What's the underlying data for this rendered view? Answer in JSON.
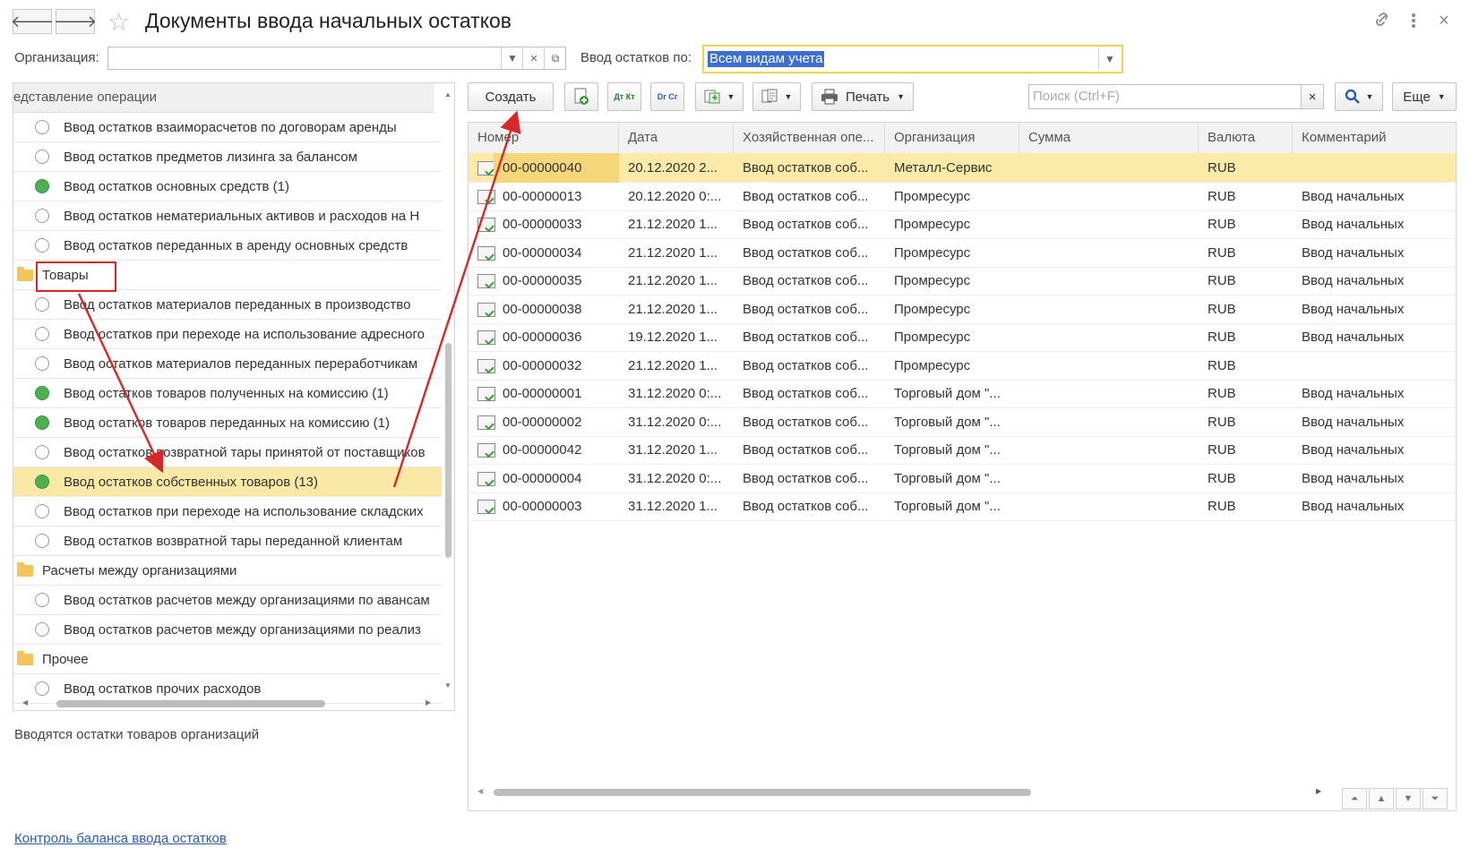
{
  "window": {
    "title": "Документы ввода начальных остатков",
    "back_label": "🡐",
    "forward_label": "🡒",
    "star_icon": "star-icon",
    "link_icon": "link-icon",
    "more_icon": "more-vertical-icon",
    "close_label": "×"
  },
  "filters": {
    "org_label": "Организация:",
    "org_value": "",
    "entry_label": "Ввод остатков по:",
    "entry_value": "Всем видам учета"
  },
  "tree": {
    "header": "едставление операции",
    "items": [
      {
        "type": "radio",
        "label": "Ввод остатков взаиморасчетов по договорам аренды",
        "checked": false
      },
      {
        "type": "radio",
        "label": "Ввод остатков предметов лизинга за балансом",
        "checked": false
      },
      {
        "type": "radio",
        "label": "Ввод остатков основных средств (1)",
        "checked": true
      },
      {
        "type": "radio",
        "label": "Ввод остатков нематериальных активов и расходов на Н",
        "checked": false
      },
      {
        "type": "radio",
        "label": "Ввод остатков переданных в аренду основных средств",
        "checked": false
      },
      {
        "type": "folder",
        "label": "Товары"
      },
      {
        "type": "radio",
        "label": "Ввод остатков материалов переданных в производство",
        "checked": false
      },
      {
        "type": "radio",
        "label": "Ввод остатков при переходе на использование адресного",
        "checked": false
      },
      {
        "type": "radio",
        "label": "Ввод остатков материалов переданных переработчикам",
        "checked": false
      },
      {
        "type": "radio",
        "label": "Ввод остатков товаров полученных на комиссию (1)",
        "checked": true
      },
      {
        "type": "radio",
        "label": "Ввод остатков товаров переданных на комиссию (1)",
        "checked": true
      },
      {
        "type": "radio",
        "label": "Ввод остатков возвратной тары принятой от поставщиков",
        "checked": false
      },
      {
        "type": "radio",
        "label": "Ввод остатков собственных товаров (13)",
        "checked": true,
        "selected": true
      },
      {
        "type": "radio",
        "label": "Ввод остатков при переходе на использование складских",
        "checked": false
      },
      {
        "type": "radio",
        "label": "Ввод остатков возвратной тары переданной клиентам",
        "checked": false
      },
      {
        "type": "folder",
        "label": "Расчеты между организациями"
      },
      {
        "type": "radio",
        "label": "Ввод остатков расчетов между организациями по авансам",
        "checked": false
      },
      {
        "type": "radio",
        "label": "Ввод остатков расчетов между организациями по реализ",
        "checked": false
      },
      {
        "type": "folder",
        "label": "Прочее"
      },
      {
        "type": "radio",
        "label": "Ввод остатков прочих расходов",
        "checked": false
      }
    ]
  },
  "hint": "Вводятся остатки товаров организаций",
  "balance_link": "Контроль баланса ввода остатков",
  "toolbar": {
    "create_label": "Создать",
    "dtkt_label": "Дт Кт",
    "drcr_label": "Dr Cr",
    "print_label": "Печать",
    "search_placeholder": "Поиск (Ctrl+F)",
    "more_label": "Еще"
  },
  "grid": {
    "columns": [
      "Номер",
      "Дата",
      "Хозяйственная опе...",
      "Организация",
      "Сумма",
      "Валюта",
      "Комментарий"
    ],
    "rows": [
      {
        "num": "00-00000040",
        "date": "20.12.2020 2...",
        "op": "Ввод остатков соб...",
        "org": "Металл-Сервис",
        "sum": "",
        "cur": "RUB",
        "comment": "",
        "selected": true
      },
      {
        "num": "00-00000013",
        "date": "20.12.2020 0:...",
        "op": "Ввод остатков соб...",
        "org": "Промресурс",
        "sum": "",
        "cur": "RUB",
        "comment": "Ввод начальных"
      },
      {
        "num": "00-00000033",
        "date": "21.12.2020 1...",
        "op": "Ввод остатков соб...",
        "org": "Промресурс",
        "sum": "",
        "cur": "RUB",
        "comment": "Ввод начальных"
      },
      {
        "num": "00-00000034",
        "date": "21.12.2020 1...",
        "op": "Ввод остатков соб...",
        "org": "Промресурс",
        "sum": "",
        "cur": "RUB",
        "comment": "Ввод начальных"
      },
      {
        "num": "00-00000035",
        "date": "21.12.2020 1...",
        "op": "Ввод остатков соб...",
        "org": "Промресурс",
        "sum": "",
        "cur": "RUB",
        "comment": "Ввод начальных"
      },
      {
        "num": "00-00000038",
        "date": "21.12.2020 1...",
        "op": "Ввод остатков соб...",
        "org": "Промресурс",
        "sum": "",
        "cur": "RUB",
        "comment": "Ввод начальных"
      },
      {
        "num": "00-00000036",
        "date": "19.12.2020 1...",
        "op": "Ввод остатков соб...",
        "org": "Промресурс",
        "sum": "",
        "cur": "RUB",
        "comment": "Ввод начальных"
      },
      {
        "num": "00-00000032",
        "date": "21.12.2020 1...",
        "op": "Ввод остатков соб...",
        "org": "Промресурс",
        "sum": "",
        "cur": "RUB",
        "comment": ""
      },
      {
        "num": "00-00000001",
        "date": "31.12.2020 0:...",
        "op": "Ввод остатков соб...",
        "org": "Торговый дом \"...",
        "sum": "",
        "cur": "RUB",
        "comment": "Ввод начальных"
      },
      {
        "num": "00-00000002",
        "date": "31.12.2020 0:...",
        "op": "Ввод остатков соб...",
        "org": "Торговый дом \"...",
        "sum": "",
        "cur": "RUB",
        "comment": "Ввод начальных"
      },
      {
        "num": "00-00000042",
        "date": "31.12.2020 1...",
        "op": "Ввод остатков соб...",
        "org": "Торговый дом \"...",
        "sum": "",
        "cur": "RUB",
        "comment": "Ввод начальных"
      },
      {
        "num": "00-00000004",
        "date": "31.12.2020 0:...",
        "op": "Ввод остатков соб...",
        "org": "Торговый дом \"...",
        "sum": "",
        "cur": "RUB",
        "comment": "Ввод начальных"
      },
      {
        "num": "00-00000003",
        "date": "31.12.2020 1...",
        "op": "Ввод остатков соб...",
        "org": "Торговый дом \"...",
        "sum": "",
        "cur": "RUB",
        "comment": "Ввод начальных"
      }
    ]
  },
  "colors": {
    "selected_row": "#fbeaa8",
    "highlight_field": "#f2d44c",
    "annotation": "#d62828",
    "radio_on": "#4caf50"
  }
}
